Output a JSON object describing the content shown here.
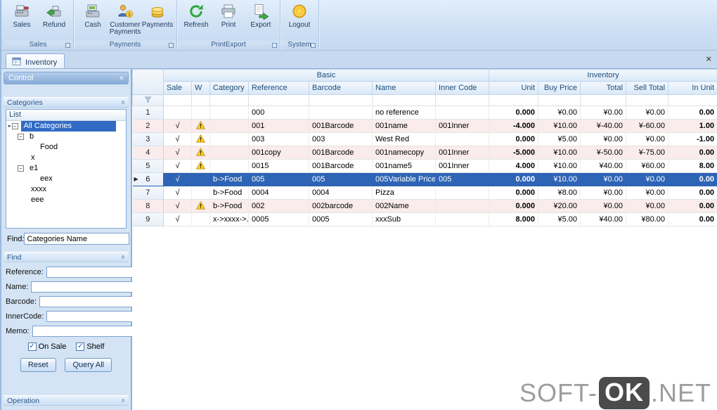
{
  "ribbon": {
    "groups": [
      {
        "label": "Sales",
        "buttons": [
          {
            "label": "Sales",
            "icon": "sales-icon"
          },
          {
            "label": "Refund",
            "icon": "refund-icon"
          }
        ]
      },
      {
        "label": "Payments",
        "buttons": [
          {
            "label": "Cash",
            "icon": "cash-icon"
          },
          {
            "label": "Customer Payments",
            "icon": "customer-payments-icon"
          },
          {
            "label": "Payments",
            "icon": "payments-icon"
          }
        ]
      },
      {
        "label": "PrintExport",
        "buttons": [
          {
            "label": "Refresh",
            "icon": "refresh-icon"
          },
          {
            "label": "Print",
            "icon": "print-icon"
          },
          {
            "label": "Export",
            "icon": "export-icon"
          }
        ]
      },
      {
        "label": "System",
        "buttons": [
          {
            "label": "Logout",
            "icon": "logout-icon"
          }
        ]
      }
    ]
  },
  "tab_bar": {
    "tabs": [
      {
        "label": "Inventory"
      }
    ],
    "close_icon": "×"
  },
  "sidebar": {
    "control_title": "Control",
    "collapse_icon": "«",
    "categories": {
      "title": "Categories",
      "list_header": "List",
      "tree": [
        {
          "label": "All Categories",
          "level": 0,
          "expandable": true,
          "selected": true
        },
        {
          "label": "b",
          "level": 1,
          "expandable": true,
          "selected": false
        },
        {
          "label": "Food",
          "level": 2,
          "expandable": false,
          "selected": false
        },
        {
          "label": "x",
          "level": 1,
          "expandable": false,
          "selected": false
        },
        {
          "label": "e1",
          "level": 1,
          "expandable": true,
          "selected": false
        },
        {
          "label": "eex",
          "level": 2,
          "expandable": false,
          "selected": false
        },
        {
          "label": "xxxx",
          "level": 1,
          "expandable": false,
          "selected": false
        },
        {
          "label": "eee",
          "level": 1,
          "expandable": false,
          "selected": false
        }
      ],
      "find_label": "Find:",
      "find_value": "Categories Name"
    },
    "find": {
      "title": "Find",
      "fields": [
        {
          "label": "Reference:",
          "value": ""
        },
        {
          "label": "Name:",
          "value": ""
        },
        {
          "label": "Barcode:",
          "value": ""
        },
        {
          "label": "InnerCode:",
          "value": ""
        },
        {
          "label": "Memo:",
          "value": ""
        }
      ],
      "checkboxes": [
        {
          "label": "On Sale",
          "checked": true
        },
        {
          "label": "Shelf",
          "checked": true
        }
      ],
      "buttons": [
        {
          "label": "Reset"
        },
        {
          "label": "Query All"
        }
      ]
    },
    "operation_title": "Operation"
  },
  "grid": {
    "band_headers": [
      {
        "label": "Basic"
      },
      {
        "label": "Inventory"
      }
    ],
    "columns": [
      "Sale",
      "W",
      "Category",
      "Reference",
      "Barcode",
      "Name",
      "Inner Code",
      "Unit",
      "Buy Price",
      "Total",
      "Sell Total",
      "In Unit"
    ],
    "rows": [
      {
        "num": "1",
        "sale": false,
        "warning": false,
        "category": "",
        "reference": "000",
        "barcode": "",
        "name": "no reference",
        "inner_code": "",
        "unit": "0.000",
        "buy_price": "¥0.00",
        "total": "¥0.00",
        "sell_total": "¥0.00",
        "in_unit": "0.00",
        "selected": false
      },
      {
        "num": "2",
        "sale": true,
        "warning": true,
        "category": "",
        "reference": "001",
        "barcode": "001Barcode",
        "name": "001name",
        "inner_code": "001Inner",
        "unit": "-4.000",
        "buy_price": "¥10.00",
        "total": "¥-40.00",
        "sell_total": "¥-60.00",
        "in_unit": "1.00",
        "selected": false
      },
      {
        "num": "3",
        "sale": true,
        "warning": true,
        "category": "",
        "reference": "003",
        "barcode": "003",
        "name": "West Red",
        "inner_code": "",
        "unit": "0.000",
        "buy_price": "¥5.00",
        "total": "¥0.00",
        "sell_total": "¥0.00",
        "in_unit": "-1.00",
        "selected": false
      },
      {
        "num": "4",
        "sale": true,
        "warning": true,
        "category": "",
        "reference": "001copy",
        "barcode": "001Barcode",
        "name": "001namecopy",
        "inner_code": "001Inner",
        "unit": "-5.000",
        "buy_price": "¥10.00",
        "total": "¥-50.00",
        "sell_total": "¥-75.00",
        "in_unit": "0.00",
        "selected": false
      },
      {
        "num": "5",
        "sale": true,
        "warning": true,
        "category": "",
        "reference": "0015",
        "barcode": "001Barcode",
        "name": "001name5",
        "inner_code": "001Inner",
        "unit": "4.000",
        "buy_price": "¥10.00",
        "total": "¥40.00",
        "sell_total": "¥60.00",
        "in_unit": "8.00",
        "selected": false
      },
      {
        "num": "6",
        "sale": true,
        "warning": false,
        "category": "b->Food",
        "reference": "005",
        "barcode": "005",
        "name": "005Variable Price",
        "inner_code": "005",
        "unit": "0.000",
        "buy_price": "¥10.00",
        "total": "¥0.00",
        "sell_total": "¥0.00",
        "in_unit": "0.00",
        "selected": true
      },
      {
        "num": "7",
        "sale": true,
        "warning": false,
        "category": "b->Food",
        "reference": "0004",
        "barcode": "0004",
        "name": "Pizza",
        "inner_code": "",
        "unit": "0.000",
        "buy_price": "¥8.00",
        "total": "¥0.00",
        "sell_total": "¥0.00",
        "in_unit": "0.00",
        "selected": false
      },
      {
        "num": "8",
        "sale": true,
        "warning": true,
        "category": "b->Food",
        "reference": "002",
        "barcode": "002barcode",
        "name": "002Name",
        "inner_code": "",
        "unit": "0.000",
        "buy_price": "¥20.00",
        "total": "¥0.00",
        "sell_total": "¥0.00",
        "in_unit": "0.00",
        "selected": false
      },
      {
        "num": "9",
        "sale": true,
        "warning": false,
        "category": "x->xxxx->...",
        "reference": "0005",
        "barcode": "0005",
        "name": "xxxSub",
        "inner_code": "",
        "unit": "8.000",
        "buy_price": "¥5.00",
        "total": "¥40.00",
        "sell_total": "¥80.00",
        "in_unit": "0.00",
        "selected": false
      }
    ]
  },
  "colors": {
    "selection": "#2e64b5",
    "alt_row": "#faecec",
    "header_text": "#1f4e79",
    "warning_yellow": "#ffd21e"
  },
  "watermark": {
    "prefix": "SOFT-",
    "badge": "OK",
    "suffix": ".NET"
  }
}
